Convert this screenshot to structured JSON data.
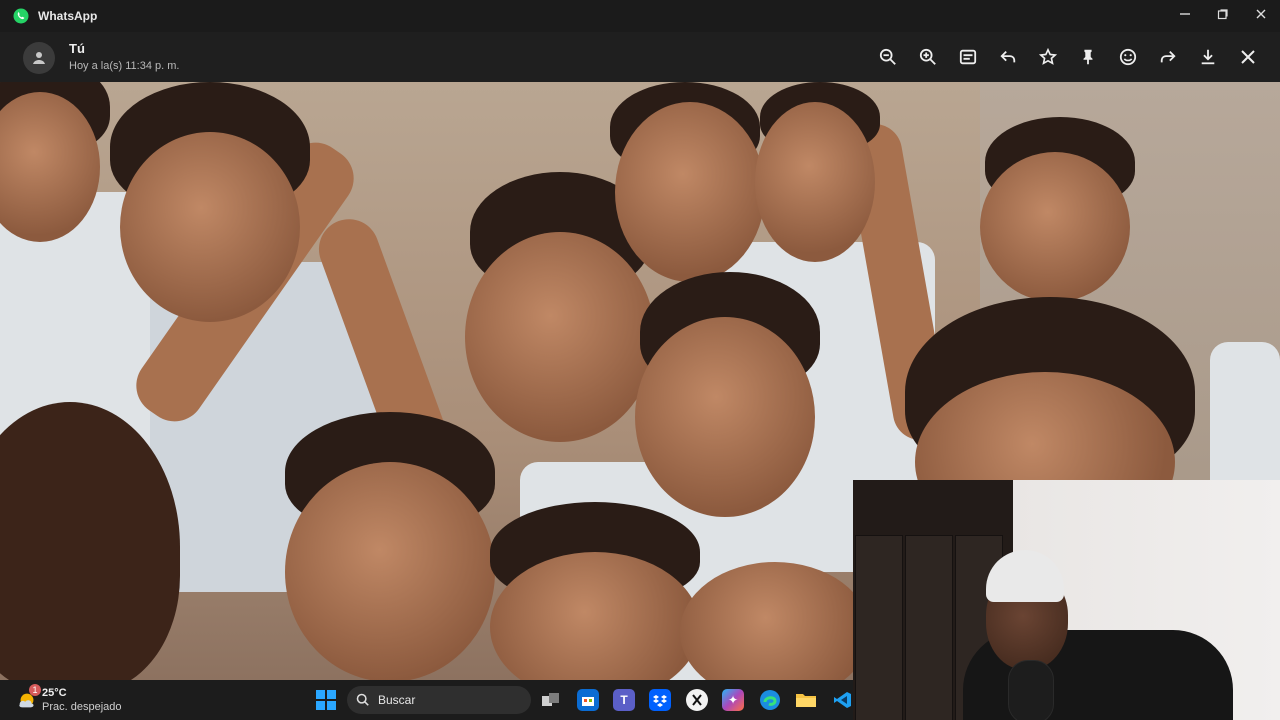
{
  "window": {
    "app_name": "WhatsApp",
    "controls": [
      "minimize",
      "maximize",
      "close"
    ]
  },
  "viewer": {
    "sender": "Tú",
    "timestamp": "Hoy a la(s) 11:34 p. m.",
    "toolbar": [
      "zoom-out-icon",
      "zoom-in-icon",
      "caption-icon",
      "reply-icon",
      "star-icon",
      "pin-icon",
      "emoji-icon",
      "forward-icon",
      "download-icon",
      "close-icon"
    ]
  },
  "taskbar": {
    "weather_temp": "25°C",
    "weather_desc": "Prac. despejado",
    "badge_count": "1",
    "search_placeholder": "Buscar",
    "apps": [
      "task-view",
      "store",
      "teams",
      "dropbox",
      "xbox",
      "copilot",
      "edge",
      "file-explorer",
      "vscode"
    ]
  },
  "colors": {
    "titlebar": "#1b1b1b",
    "header": "#1f1f1f",
    "taskbar": "#1c1c1c",
    "whatsapp_green": "#25D366"
  }
}
